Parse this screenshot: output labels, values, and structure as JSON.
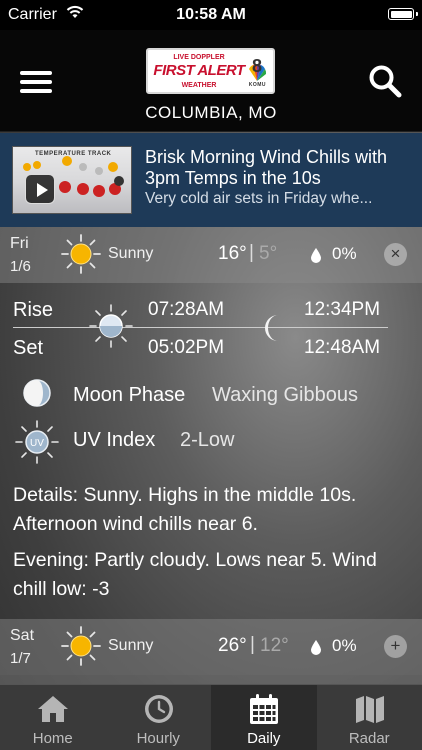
{
  "status_bar": {
    "carrier": "Carrier",
    "time": "10:58 AM"
  },
  "header": {
    "logo_top": "LIVE DOPPLER",
    "logo_main": "FIRST ALERT",
    "logo_bottom": "WEATHER",
    "logo_channel": "8",
    "logo_call": "KOMU",
    "location": "COLUMBIA, MO"
  },
  "news": {
    "thumbnail_title": "TEMPERATURE TRACK",
    "title": "Brisk Morning Wind Chills with 3pm Temps in the 10s",
    "subtitle": "Very cold air sets in Friday whe..."
  },
  "days": [
    {
      "name": "Fri",
      "date": "1/6",
      "condition": "Sunny",
      "high": "16°",
      "separator": "|",
      "low": "5°",
      "precip": "0%",
      "toggle": "×"
    },
    {
      "name": "Sat",
      "date": "1/7",
      "condition": "Sunny",
      "high": "26°",
      "separator": "|",
      "low": "12°",
      "precip": "0%",
      "toggle": "+"
    }
  ],
  "details": {
    "rise_label": "Rise",
    "set_label": "Set",
    "sunrise": "07:28AM",
    "sunset": "05:02PM",
    "moonrise": "12:34PM",
    "moonset": "12:48AM",
    "moon_phase_label": "Moon Phase",
    "moon_phase_value": "Waxing Gibbous",
    "uv_label": "UV Index",
    "uv_value": "2-Low",
    "uv_icon_text": "UV",
    "details_text": "Details: Sunny. Highs in the middle 10s. Afternoon wind chills near 6.",
    "evening_text": "Evening: Partly cloudy. Lows near 5. Wind chill low: -3"
  },
  "tabs": [
    {
      "label": "Home",
      "icon": "home-icon"
    },
    {
      "label": "Hourly",
      "icon": "clock-icon"
    },
    {
      "label": "Daily",
      "icon": "calendar-icon",
      "selected": true
    },
    {
      "label": "Radar",
      "icon": "map-icon"
    }
  ],
  "colors": {
    "sun": "#f7b500",
    "news_bg": "#1e3a58",
    "logo_red": "#c8102e"
  }
}
